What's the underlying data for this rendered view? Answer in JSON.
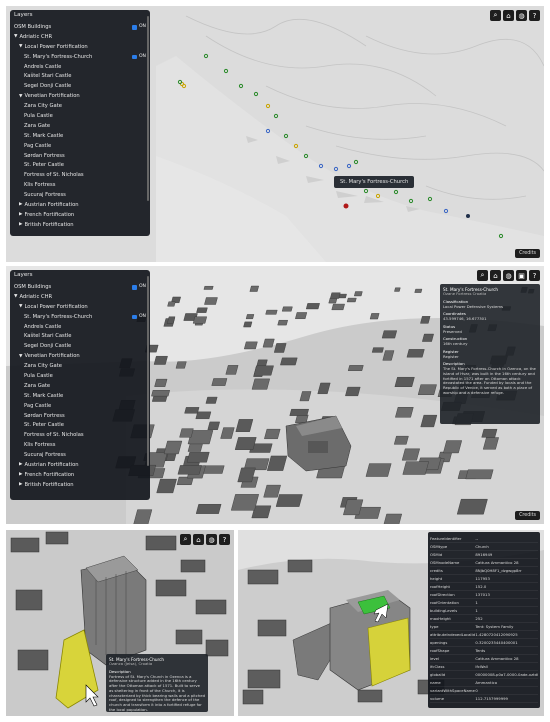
{
  "panel1": {
    "layers_title": "Layers",
    "osm_label": "OSM Buildings",
    "on": "ON",
    "items": [
      {
        "level": 0,
        "type": "group",
        "label": "Adriatic CHR"
      },
      {
        "level": 1,
        "type": "group",
        "label": "Local Power Fortification"
      },
      {
        "level": 2,
        "type": "item",
        "label": "St. Mary's Fortress-Church",
        "checked": true
      },
      {
        "level": 2,
        "type": "item",
        "label": "Andreis Castle"
      },
      {
        "level": 2,
        "type": "item",
        "label": "Kaštel Stari Castle"
      },
      {
        "level": 2,
        "type": "item",
        "label": "Segel Donji Castle"
      },
      {
        "level": 1,
        "type": "group",
        "label": "Venetian Fortification"
      },
      {
        "level": 2,
        "type": "item",
        "label": "Zara City Gate"
      },
      {
        "level": 2,
        "type": "item",
        "label": "Pula Castle"
      },
      {
        "level": 2,
        "type": "item",
        "label": "Zara Gate"
      },
      {
        "level": 2,
        "type": "item",
        "label": "St. Mark Castle"
      },
      {
        "level": 2,
        "type": "item",
        "label": "Pag Castle"
      },
      {
        "level": 2,
        "type": "item",
        "label": "Sørdan Fortress"
      },
      {
        "level": 2,
        "type": "item",
        "label": "St. Peter Castle"
      },
      {
        "level": 2,
        "type": "item",
        "label": "Fortress of St. Nicholas"
      },
      {
        "level": 2,
        "type": "item",
        "label": "Klis Fortress"
      },
      {
        "level": 2,
        "type": "item",
        "label": "Sucuraj Fortress"
      },
      {
        "level": 1,
        "type": "collapsed",
        "label": "Austrian Fortification"
      },
      {
        "level": 1,
        "type": "collapsed",
        "label": "French Fortification"
      },
      {
        "level": 1,
        "type": "collapsed",
        "label": "British Fortification"
      }
    ],
    "tooltip": "St. Mary's Fortress-Church",
    "credits": "Credits"
  },
  "panel2": {
    "credits": "Credits",
    "info": {
      "title": "St. Mary's Fortress-Church",
      "subtitle": "Ozane Fortress Croatia",
      "sections": [
        {
          "key": "Classification",
          "value": "Local Power Defensive Systems"
        },
        {
          "key": "Coordinates",
          "value": "43.599746, 16.677301"
        },
        {
          "key": "Status",
          "value": "Preserved"
        },
        {
          "key": "Construction",
          "value": "16th century"
        },
        {
          "key": "Register",
          "value": "Register"
        },
        {
          "key": "Description",
          "value": "The St. Mary's Fortress-Church in Ozenca, on the island of Hvar, was built in the 16th century and fortified in 1571 after an Ottoman attack devastated the area. Funded by locals and the Republic of Venice, it served as both a place of worship and a defensive refuge."
        }
      ]
    }
  },
  "panel3": {
    "info": {
      "title": "St. Mary's Fortress-Church",
      "subtitle": "Ozanca (Jelsa), Croatia",
      "desc_key": "Description",
      "desc": "Fortress of St. Mary's Church in Ozenca is a defensive structure added in the 16th century after the Ottoman attack of 1571. Built to serve as sheltering in front of the Church, it is characterized by thick bearing walls and a pitched roof, designed to strengthen the defence of the church and transform it into a fortified refuge for the local population."
    }
  },
  "panel4": {
    "props": [
      {
        "k": "FeatureIdentifier",
        "v": "--"
      },
      {
        "k": "OSMtype",
        "v": "Church"
      },
      {
        "k": "OSMid",
        "v": "8916949"
      },
      {
        "k": "OSMnodeName",
        "v": "Cattura Ammantico 28"
      },
      {
        "k": "credits",
        "v": "8NJbQ0H8F1_dzgwgp8rr"
      },
      {
        "k": "height",
        "v": "117953"
      },
      {
        "k": "roofHeight",
        "v": "152.0"
      },
      {
        "k": "roofDirection",
        "v": "137013"
      },
      {
        "k": "roofOrientation",
        "v": "1"
      },
      {
        "k": "buildingLevels",
        "v": "1"
      },
      {
        "k": "maxHeight",
        "v": "252"
      },
      {
        "k": "type",
        "v": "Tent: System Family"
      },
      {
        "k": "attributeIndexedLocalId",
        "v": "1.4280720412090925"
      },
      {
        "k": "openings",
        "v": "0.3200235440400001"
      },
      {
        "k": "roofShape",
        "v": "Tents"
      },
      {
        "k": "level",
        "v": "Cattura Ammantico 28"
      },
      {
        "k": "ifcClass",
        "v": "IfcWall"
      },
      {
        "k": "globalId",
        "v": "00000008-p0a7-0000-0ade-xztd0m7339ca"
      },
      {
        "k": "name",
        "v": "Ammantico"
      },
      {
        "k": "variantWithSpaceName",
        "v": "0"
      },
      {
        "k": "volume",
        "v": "112.7157999999"
      }
    ]
  }
}
